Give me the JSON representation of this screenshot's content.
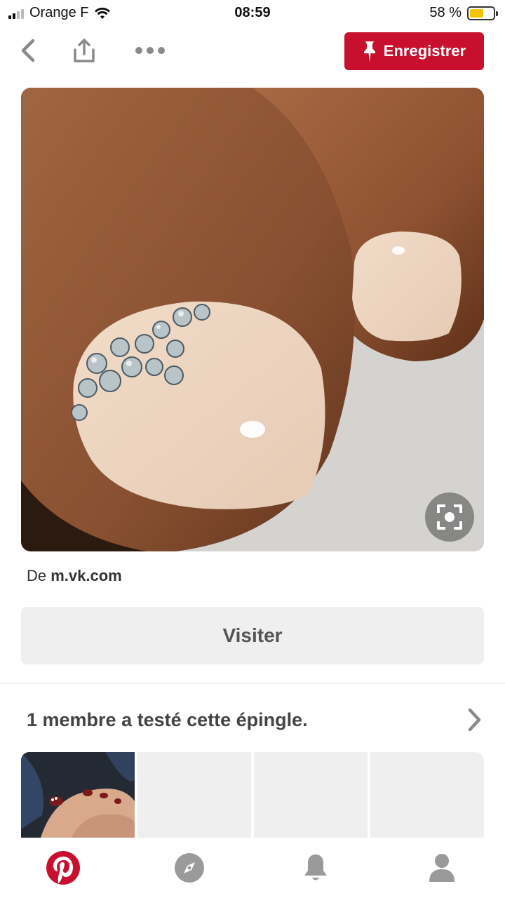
{
  "status_bar": {
    "carrier": "Orange F",
    "time": "08:59",
    "battery": "58 %"
  },
  "toolbar": {
    "save_label": "Enregistrer",
    "back_icon": "chevron-left-icon",
    "share_icon": "share-icon",
    "more_icon": "more-dots-icon"
  },
  "pin": {
    "image_alt": "Nude toenail with rhinestones",
    "lens_icon": "visual-search-icon"
  },
  "source": {
    "prefix": "De",
    "domain": "m.vk.com"
  },
  "visit_label": "Visiter",
  "tried": {
    "title": "1 membre a testé cette épingle."
  },
  "bottom_nav": {
    "items": [
      "pinterest-home-icon",
      "explore-icon",
      "notifications-icon",
      "profile-icon"
    ]
  },
  "colors": {
    "brand_red": "#c8102e",
    "button_gray": "#efefef",
    "battery_yellow": "#f5c400"
  }
}
